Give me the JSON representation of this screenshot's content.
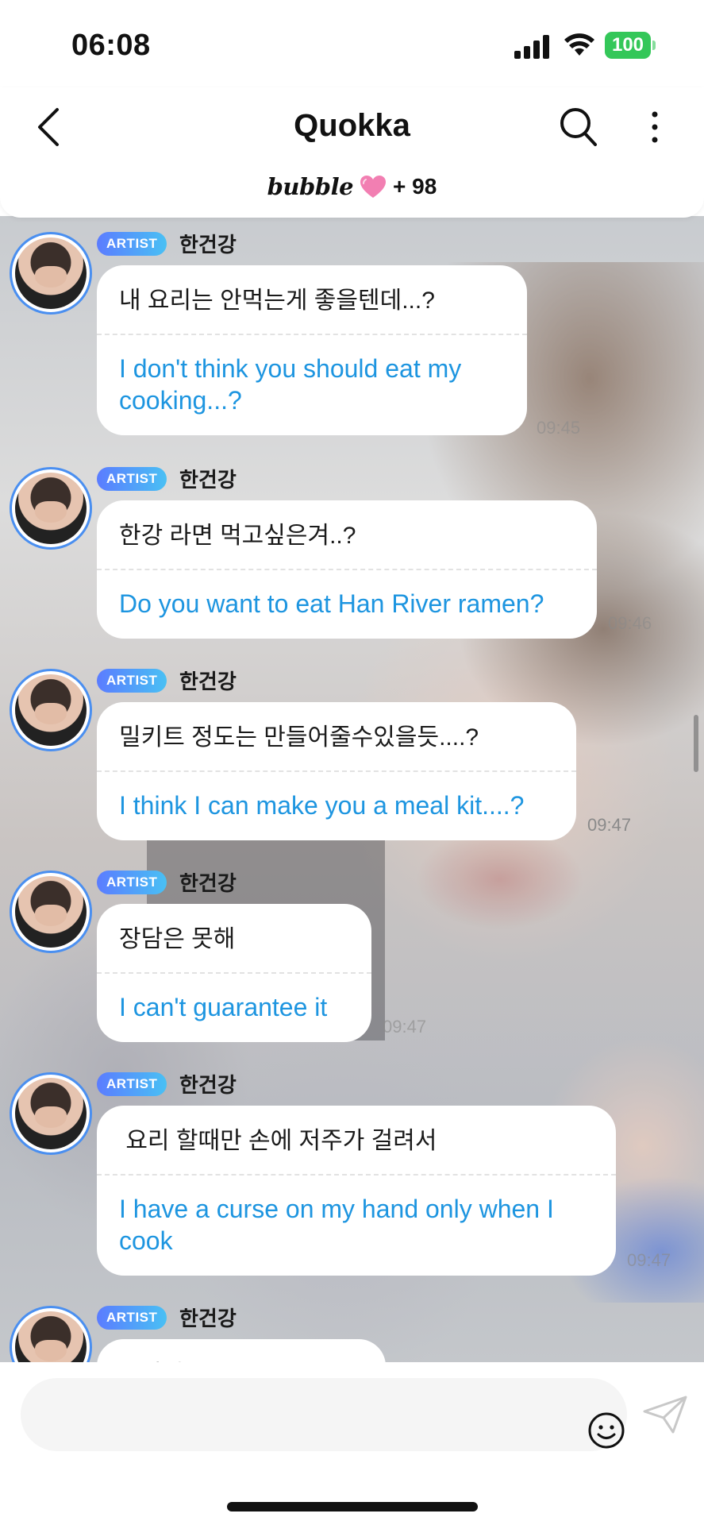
{
  "status_bar": {
    "time": "06:08",
    "battery": "100",
    "battery_color": "#34c759"
  },
  "header": {
    "title": "Quokka",
    "bubble_brand": "bubble",
    "bubble_count": "+ 98",
    "icons": [
      "chevron-left-icon",
      "search-icon",
      "more-vertical-icon",
      "heart-icon"
    ]
  },
  "messages": [
    {
      "badge": "ARTIST",
      "sender": "한건강",
      "korean": "내 요리는 안먹는게 좋을텐데...?",
      "english": "I don't think you should eat my cooking...?",
      "time": "09:45"
    },
    {
      "badge": "ARTIST",
      "sender": "한건강",
      "korean": "한강 라면 먹고싶은겨..?",
      "english": "Do you want to eat Han River ramen?",
      "time": "09:46"
    },
    {
      "badge": "ARTIST",
      "sender": "한건강",
      "korean": "밀키트 정도는 만들어줄수있을듯....?",
      "english": "I think I can make you a meal kit....?",
      "time": "09:47"
    },
    {
      "badge": "ARTIST",
      "sender": "한건강",
      "korean": "장담은 못해",
      "english": "I can't guarantee it",
      "time": "09:47"
    },
    {
      "badge": "ARTIST",
      "sender": "한건강",
      "korean": " 요리 할때만 손에 저주가 걸려서",
      "english": "I have a curse on my hand only when I cook",
      "time": "09:47"
    },
    {
      "badge": "ARTIST",
      "sender": "한건강",
      "korean": "근와나",
      "english": "",
      "time": ""
    }
  ],
  "composer": {
    "placeholder": "",
    "icons": [
      "emoji-icon",
      "send-icon"
    ]
  },
  "colors": {
    "accent_blue": "#1d95e0",
    "badge_gradient_start": "#5b7cff",
    "badge_gradient_end": "#49c0f4",
    "avatar_ring": "#4a8ff0",
    "heart_pink": "#f27fb2"
  }
}
